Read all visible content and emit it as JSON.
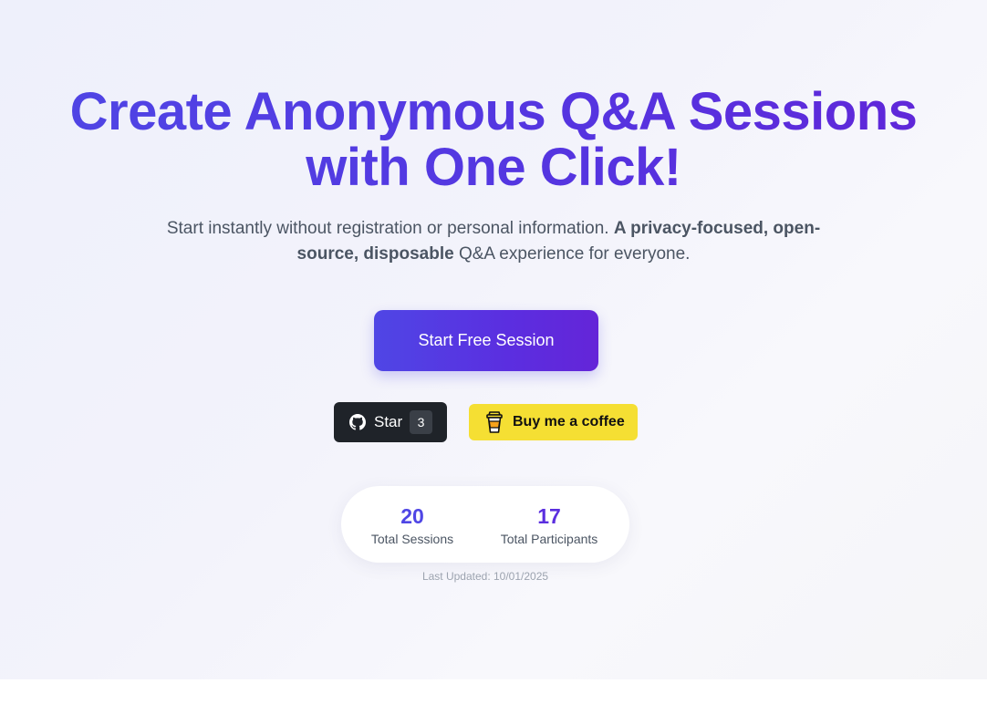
{
  "hero": {
    "headline_line1": "Create Anonymous Q&A Sessions",
    "headline_line2": "with One Click!",
    "subtitle_plain": "Start instantly without registration or personal information. ",
    "subtitle_bold": "A privacy-focused, open-source, disposable",
    "subtitle_end": " Q&A experience for everyone.",
    "cta_label": "Start Free Session"
  },
  "github": {
    "label": "Star",
    "count": "3",
    "icon": "github-icon"
  },
  "coffee": {
    "label": "Buy me a coffee",
    "icon": "coffee-cup-icon"
  },
  "stats": {
    "sessions_value": "20",
    "sessions_label": "Total Sessions",
    "participants_value": "17",
    "participants_label": "Total Participants",
    "last_updated": "Last Updated: 10/01/2025"
  },
  "colors": {
    "accent": "#4f46e5",
    "accent_end": "#6125d8",
    "github_bg": "#1f2329",
    "coffee_bg": "#f5df33"
  }
}
